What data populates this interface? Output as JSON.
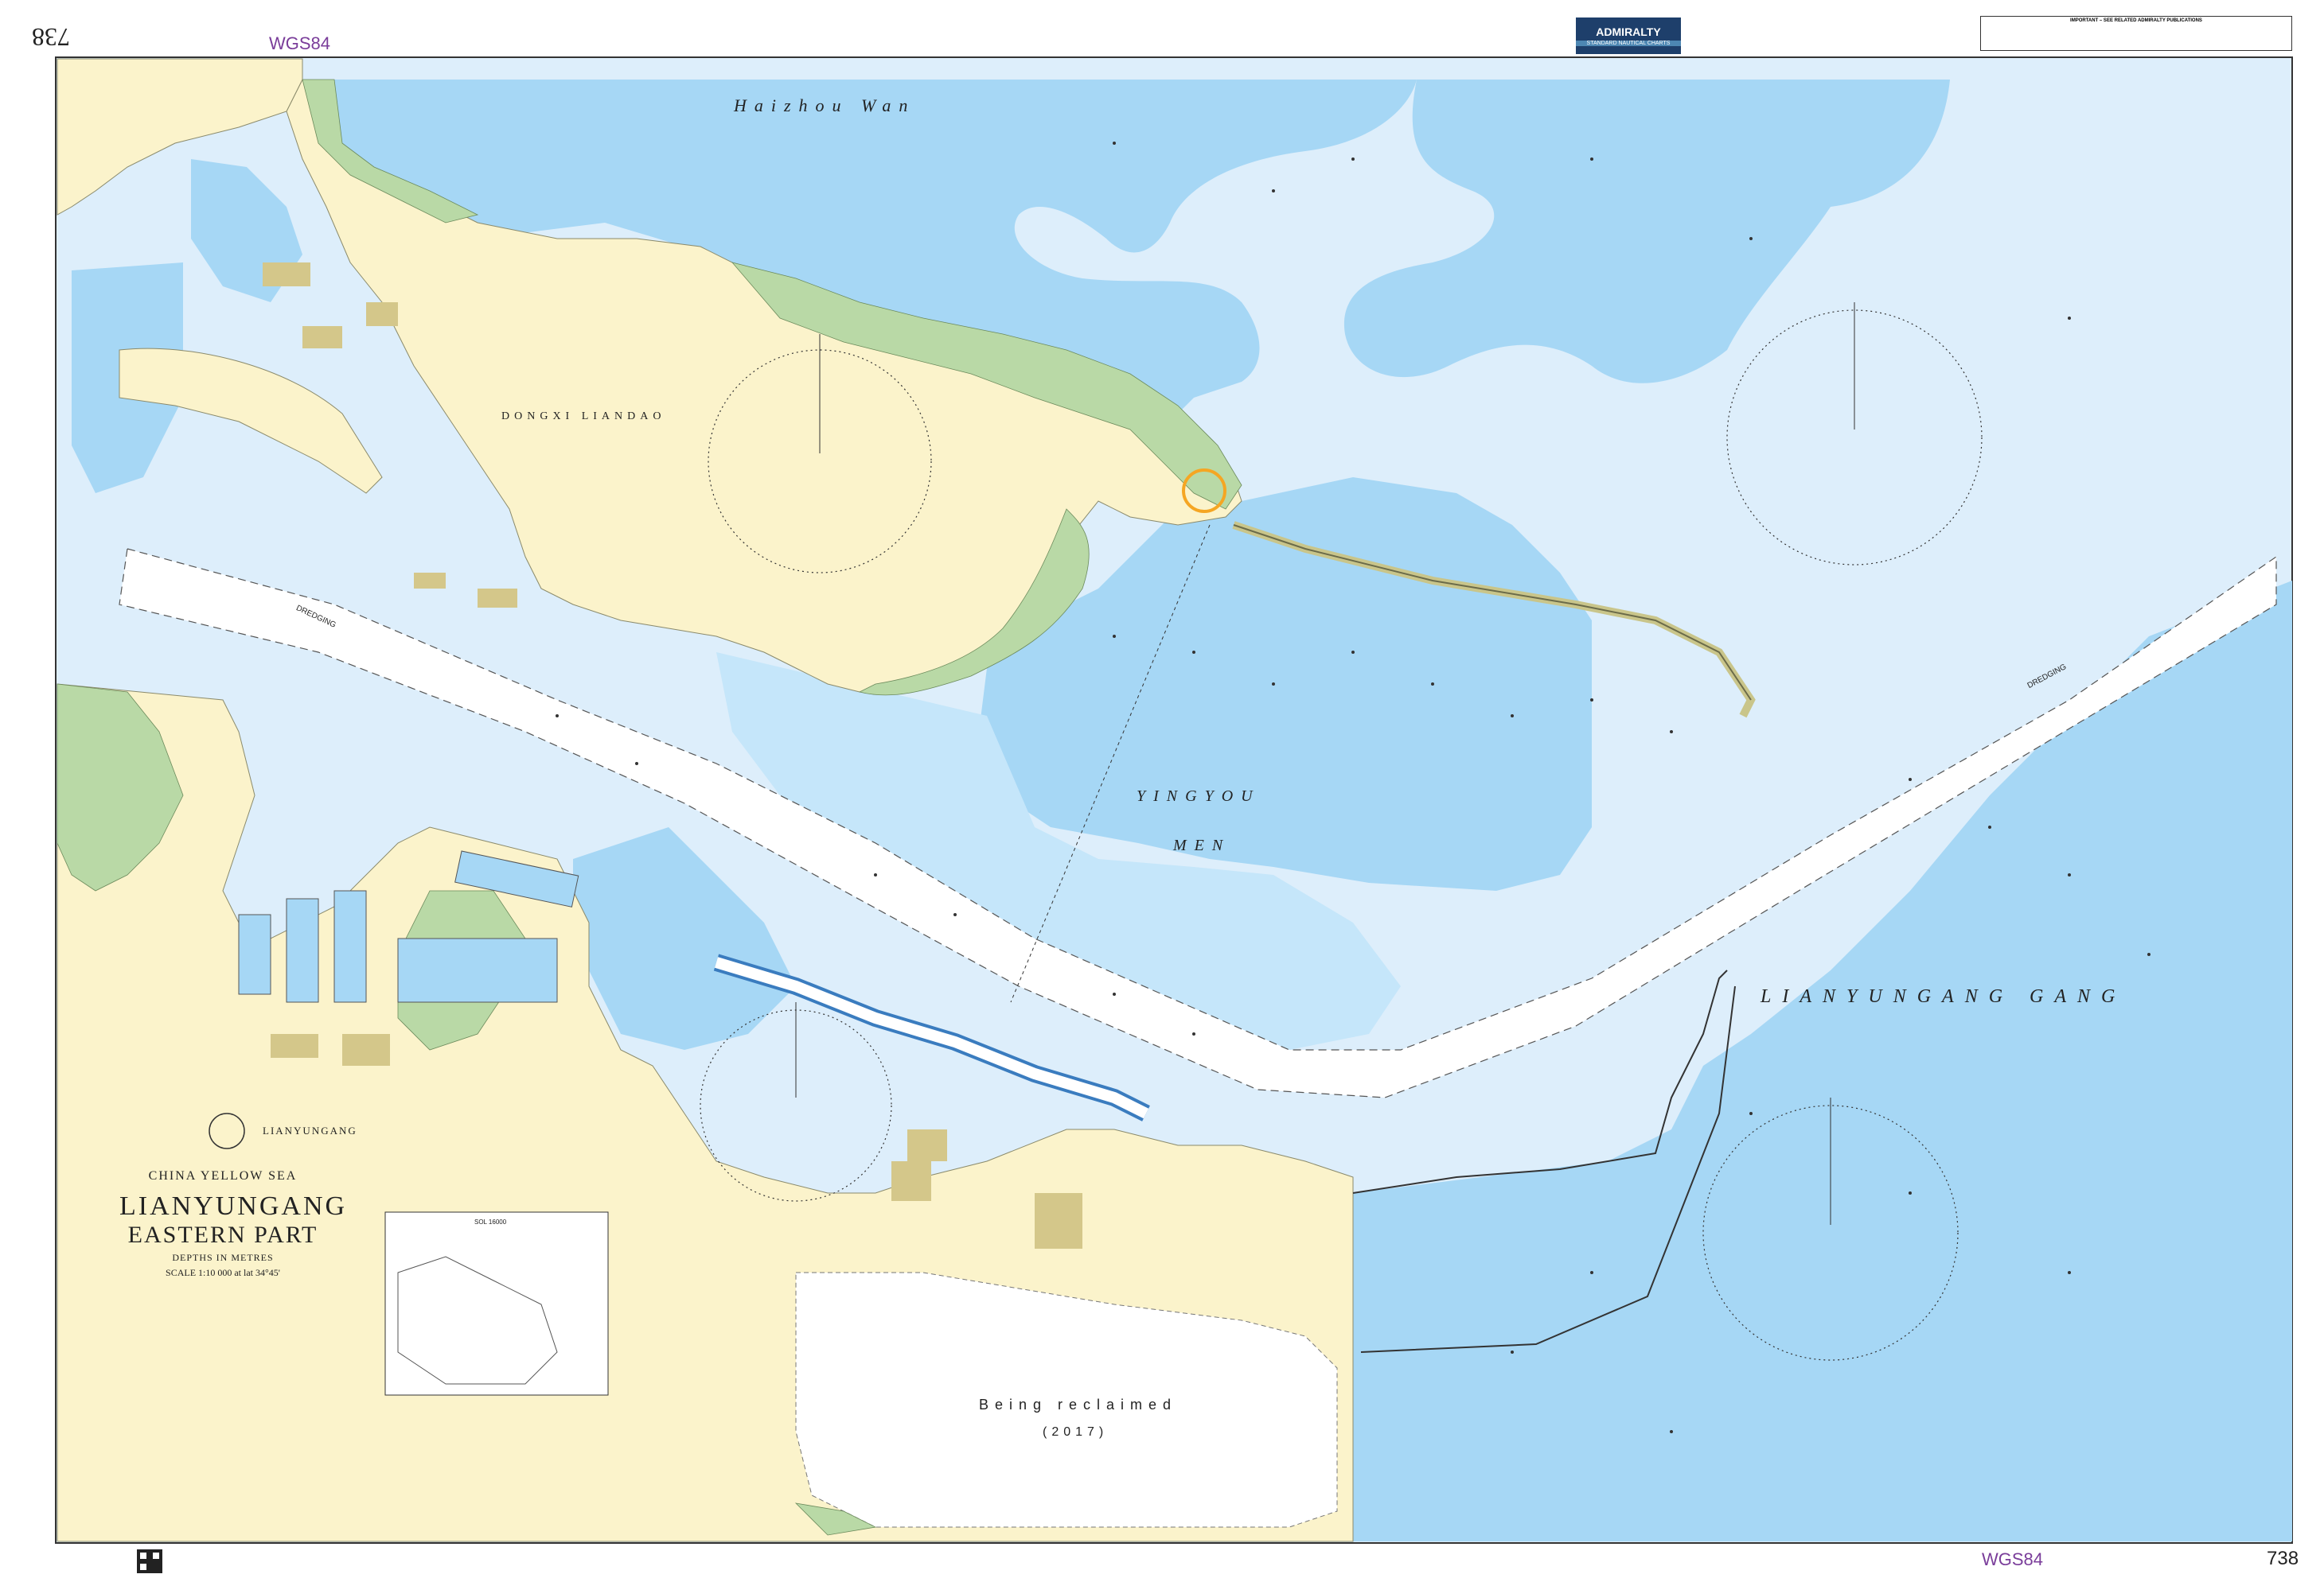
{
  "chart_number": "738",
  "datum": "WGS84",
  "publisher_badge": {
    "name": "ADMIRALTY",
    "sub": "STANDARD NAUTICAL CHARTS"
  },
  "warning_title": "IMPORTANT – SEE RELATED ADMIRALTY PUBLICATIONS",
  "title": {
    "country_sea": "CHINA    YELLOW SEA",
    "line1": "LIANYUNGANG",
    "line2": "EASTERN PART",
    "depths": "DEPTHS IN METRES",
    "scale": "SCALE 1:10 000 at lat 34°45'"
  },
  "place_names": {
    "haizhou_wan": "Haizhou Wan",
    "dongxi_liandao": "DONGXI LIANDAO",
    "yingyou": "YINGYOU",
    "men": "MEN",
    "lianyungang_gang": "LIANYUNGANG GANG",
    "lianyungang_town": "LIANYUNGANG",
    "reclaimed": "Being reclaimed",
    "reclaimed_year": "(2017)",
    "dredging": "DREDGING"
  },
  "inset_title": "SOL 16000"
}
